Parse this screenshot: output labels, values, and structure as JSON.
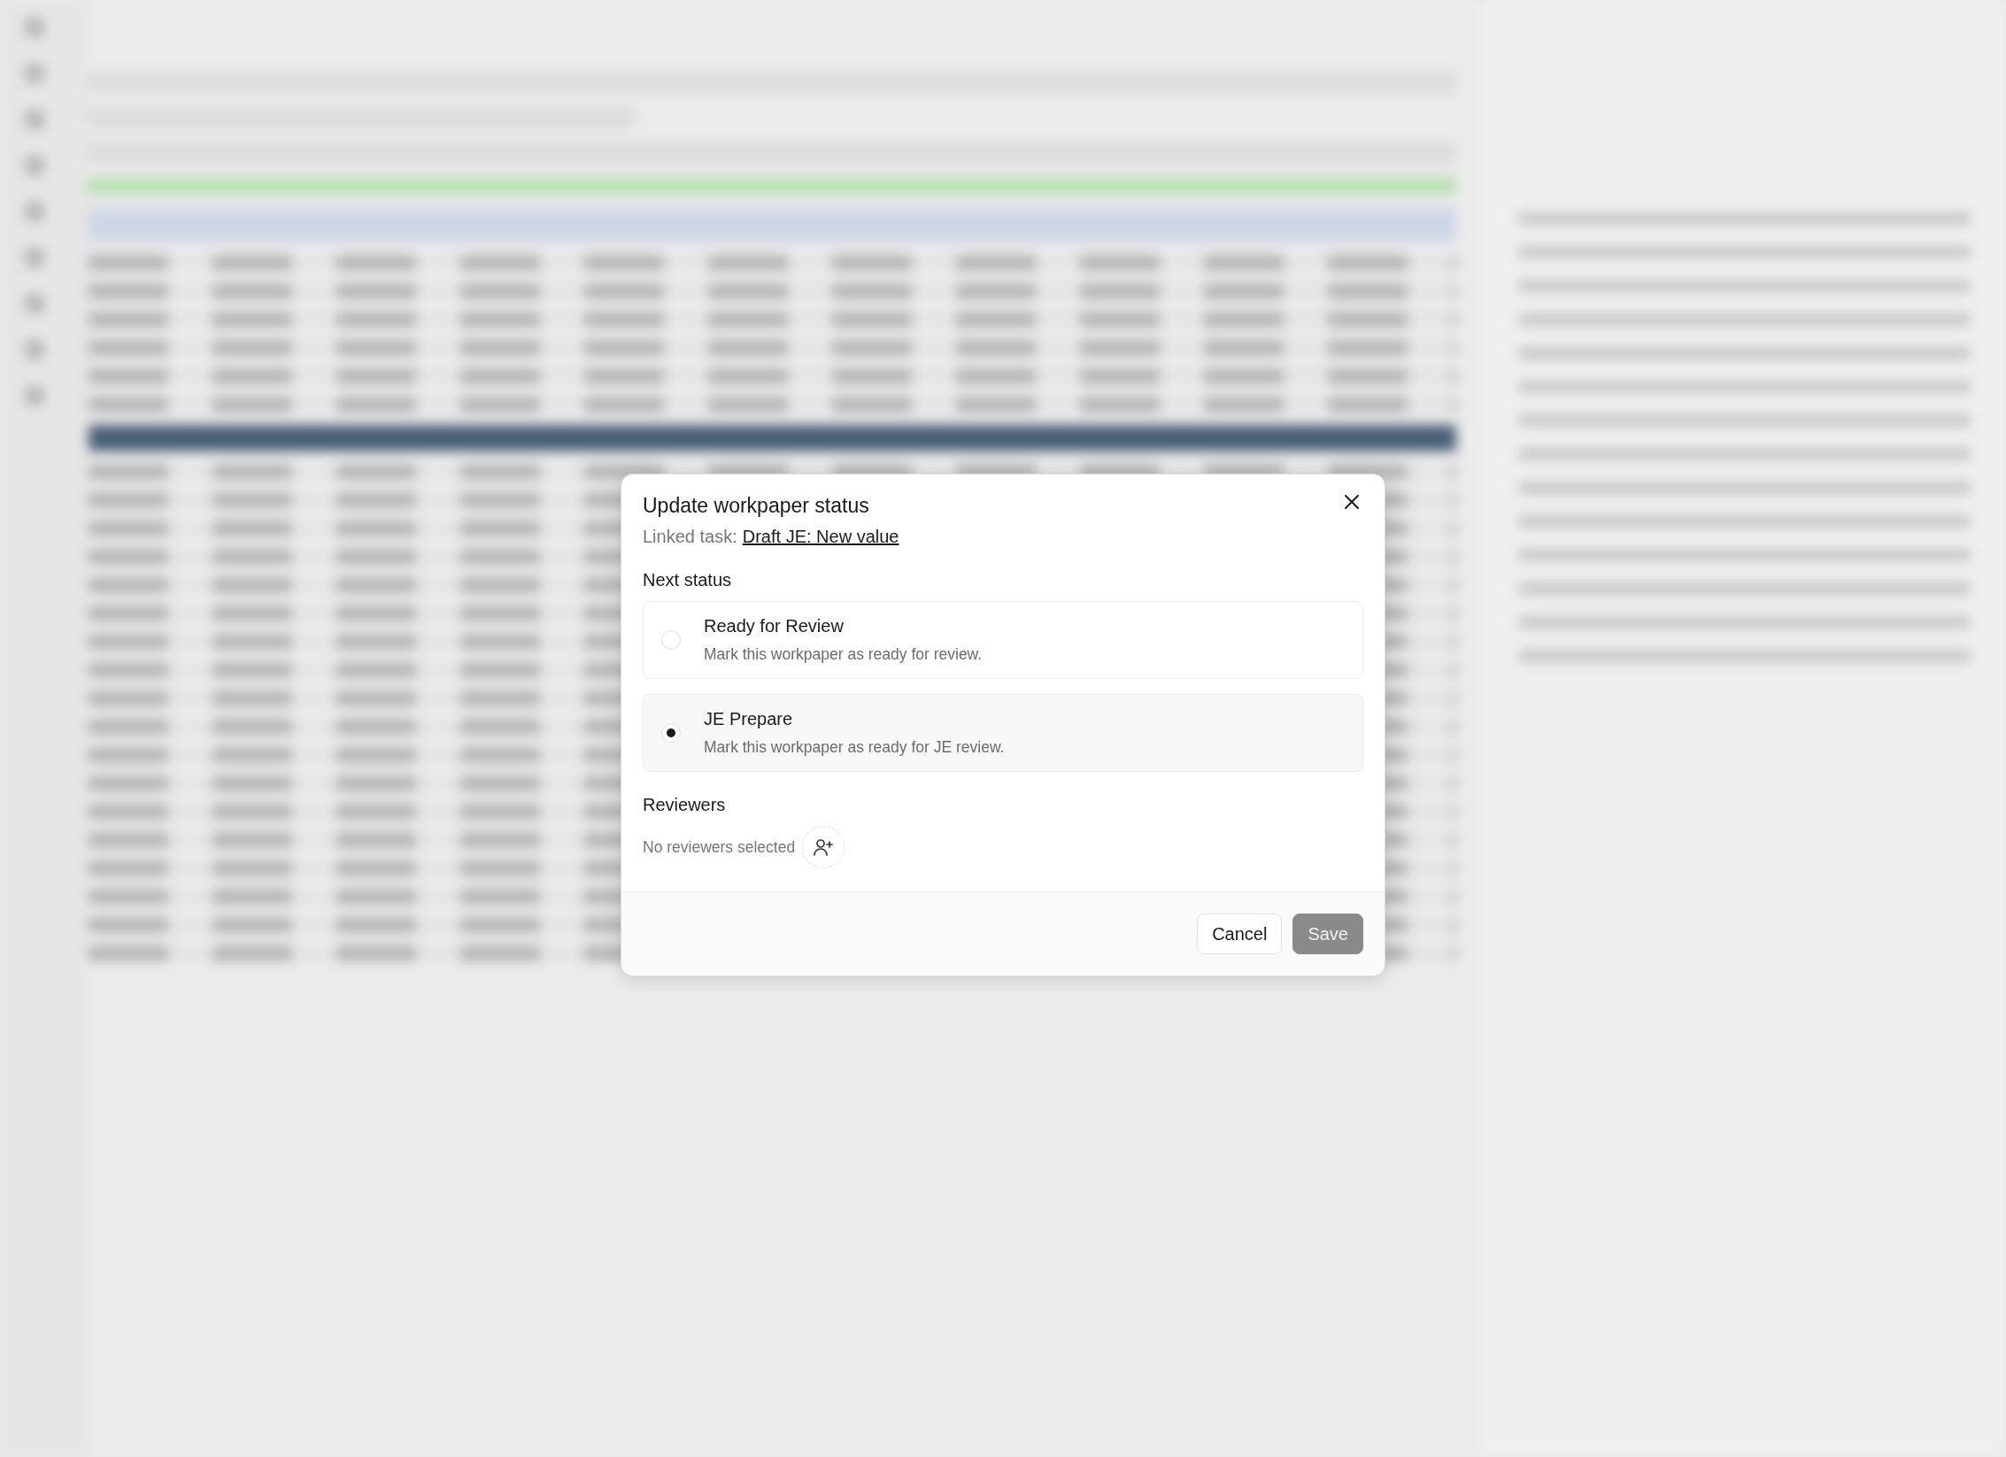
{
  "dialog": {
    "title": "Update workpaper status",
    "linked_task_label": "Linked task:",
    "linked_task": "Draft JE: New value",
    "next_status_label": "Next status",
    "options": [
      {
        "label": "Ready for Review",
        "description": "Mark this workpaper as ready for review.",
        "selected": false
      },
      {
        "label": "JE Prepare",
        "description": "Mark this workpaper as ready for JE review.",
        "selected": true
      }
    ],
    "reviewers_label": "Reviewers",
    "reviewers_empty": "No reviewers selected",
    "buttons": [
      {
        "label": "Cancel",
        "kind": "secondary",
        "disabled": false
      },
      {
        "label": "Save",
        "kind": "primary",
        "disabled": true
      }
    ]
  }
}
